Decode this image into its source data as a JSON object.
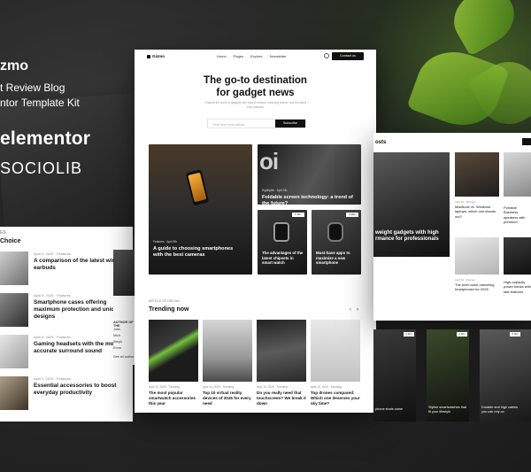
{
  "brand": {
    "name": "zmo",
    "subtitle_1": "t Review Blog",
    "subtitle_2": "ntor Template Kit",
    "builder": "elementor",
    "vendor": "SOCIOLIB"
  },
  "colors": {
    "accent_dark": "#111111",
    "background": "#2b2b2b",
    "leaf_green": "#7fbf2e"
  },
  "left_card": {
    "kicker": "ES",
    "heading": "Choice",
    "items": [
      {
        "meta": "April 9, 2025  ·  Features",
        "title": "A comparison of the latest wireless earbuds"
      },
      {
        "meta": "April 9, 2025  ·  Features",
        "title": "Smartphone cases offering maximum protection and unique designs"
      },
      {
        "meta": "April 9, 2025  ·  Features",
        "title": "Gaming headsets with the most accurate surround sound"
      },
      {
        "meta": "April 9, 2025  ·  Features",
        "title": "Essential accessories to boost everyday productivity"
      }
    ]
  },
  "mid_strip": {
    "authors_heading": "AUTHOR OF THE",
    "authors": [
      "John",
      "Mich",
      "Steph",
      "Emm"
    ],
    "see_all": "See all author"
  },
  "main": {
    "logo": "Gizmo",
    "nav_links": [
      "Home",
      "Pages",
      "Explore",
      "Newsletter"
    ],
    "contact_button": "Contact us",
    "hero_title_line1": "The go-to destination",
    "hero_title_line2": "for gadget news",
    "hero_subtitle": "Explore the world of gadgets with expert reviews, unboxing videos, and the latest tech releases.",
    "subscribe_placeholder": "Enter your email address",
    "subscribe_button": "Subscribe",
    "featured": [
      {
        "category": "Features  ·  April 9th",
        "title": "A guide to choosing smartphones with the best cameras"
      },
      {
        "category": "Highlights  ·  April 9th",
        "title": "Foldable screen technology: a trend of the future?",
        "big_text": "oi"
      },
      {
        "category": "",
        "title": "The advantages of the latest chipsets in smart watch",
        "badge": "5 Min"
      },
      {
        "category": "",
        "title": "Must-have apps to maximize a new smartphone",
        "badge": "4 Min"
      }
    ],
    "article_of_day": "ARTICLE OF THE DAY",
    "trending_title": "Trending now",
    "trending": [
      {
        "meta": "April 10, 2025  ·  Trending",
        "title": "The most popular smartwatch accessories this year"
      },
      {
        "meta": "April 10, 2025  ·  Trending",
        "title": "Top 10 virtual reality devices of 2025 for every need"
      },
      {
        "meta": "April 10, 2025  ·  Trending",
        "title": "Do you really need that touchscreen? We break it down"
      },
      {
        "meta": "April 10, 2025  ·  Trending",
        "title": "Top drones compared: Which one deserves your sky time?"
      }
    ]
  },
  "right": {
    "heading": "osts",
    "big_title": "weight gadgets with high rmance for professionals",
    "small_items": [
      {
        "meta": "April 10  ·  Review",
        "title": "MacBook vs. Windows laptops: which one stands out?"
      },
      {
        "meta": "",
        "title": "Portable Business speakers with premium..."
      },
      {
        "meta": "April 10  ·  Review",
        "title": "The best noise-canceling headphones for 2025"
      },
      {
        "meta": "",
        "title": "High-capacity power banks with fast features"
      }
    ],
    "dark_items": [
      {
        "badge": "4 Min",
        "title": "phone shots came"
      },
      {
        "badge": "4 Min",
        "title": "Stylish smartwatches that fit your lifestyle"
      },
      {
        "badge": "4 Min",
        "title": "Durable and high cables you can rely on"
      }
    ]
  }
}
